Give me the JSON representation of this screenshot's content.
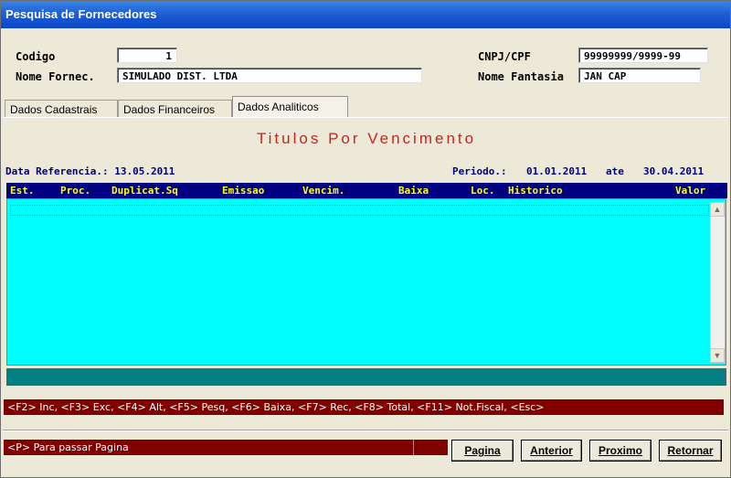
{
  "window": {
    "title": "Pesquisa de Fornecedores"
  },
  "form": {
    "codigo_label": "Codigo",
    "codigo_value": "1",
    "nome_label": "Nome Fornec.",
    "nome_value": "SIMULADO DIST. LTDA",
    "cnpj_label": "CNPJ/CPF",
    "cnpj_value": "99999999/9999-99",
    "fantasia_label": "Nome Fantasia",
    "fantasia_value": "JAN CAP"
  },
  "tabs": [
    {
      "label": "Dados Cadastrais"
    },
    {
      "label": "Dados Financeiros"
    },
    {
      "label": "Dados Analiticos",
      "active": true
    }
  ],
  "report": {
    "heading": "Titulos Por Vencimento",
    "data_referencia": "Data Referencia.: 13.05.2011",
    "periodo_label": "Periodo.:",
    "periodo_from": "01.01.2011",
    "periodo_sep": "ate",
    "periodo_to": "30.04.2011"
  },
  "table": {
    "columns": [
      "Est.",
      "Proc.",
      "Duplicat.Sq",
      "Emissao",
      "Vencim.",
      "Baixa",
      "Loc.",
      "Historico",
      "Valor"
    ],
    "rows": []
  },
  "status": {
    "keys": "<F2> Inc, <F3> Exc, <F4> Alt, <F5> Pesq, <F6> Baixa, <F7> Rec, <F8> Total, <F11> Not.Fiscal, <Esc>",
    "hint": "<P> Para passar Pagina"
  },
  "buttons": {
    "pagina": "Pagina",
    "anterior": "Anterior",
    "proximo": "Proximo",
    "retornar": "Retornar"
  },
  "colors": {
    "title_bar": "#0a46c8",
    "header_bar": "#000080",
    "header_text": "#ffff00",
    "grid": "#00ffff",
    "teal_bar": "#008080",
    "status_bar": "#800000",
    "heading": "#c0281e"
  }
}
